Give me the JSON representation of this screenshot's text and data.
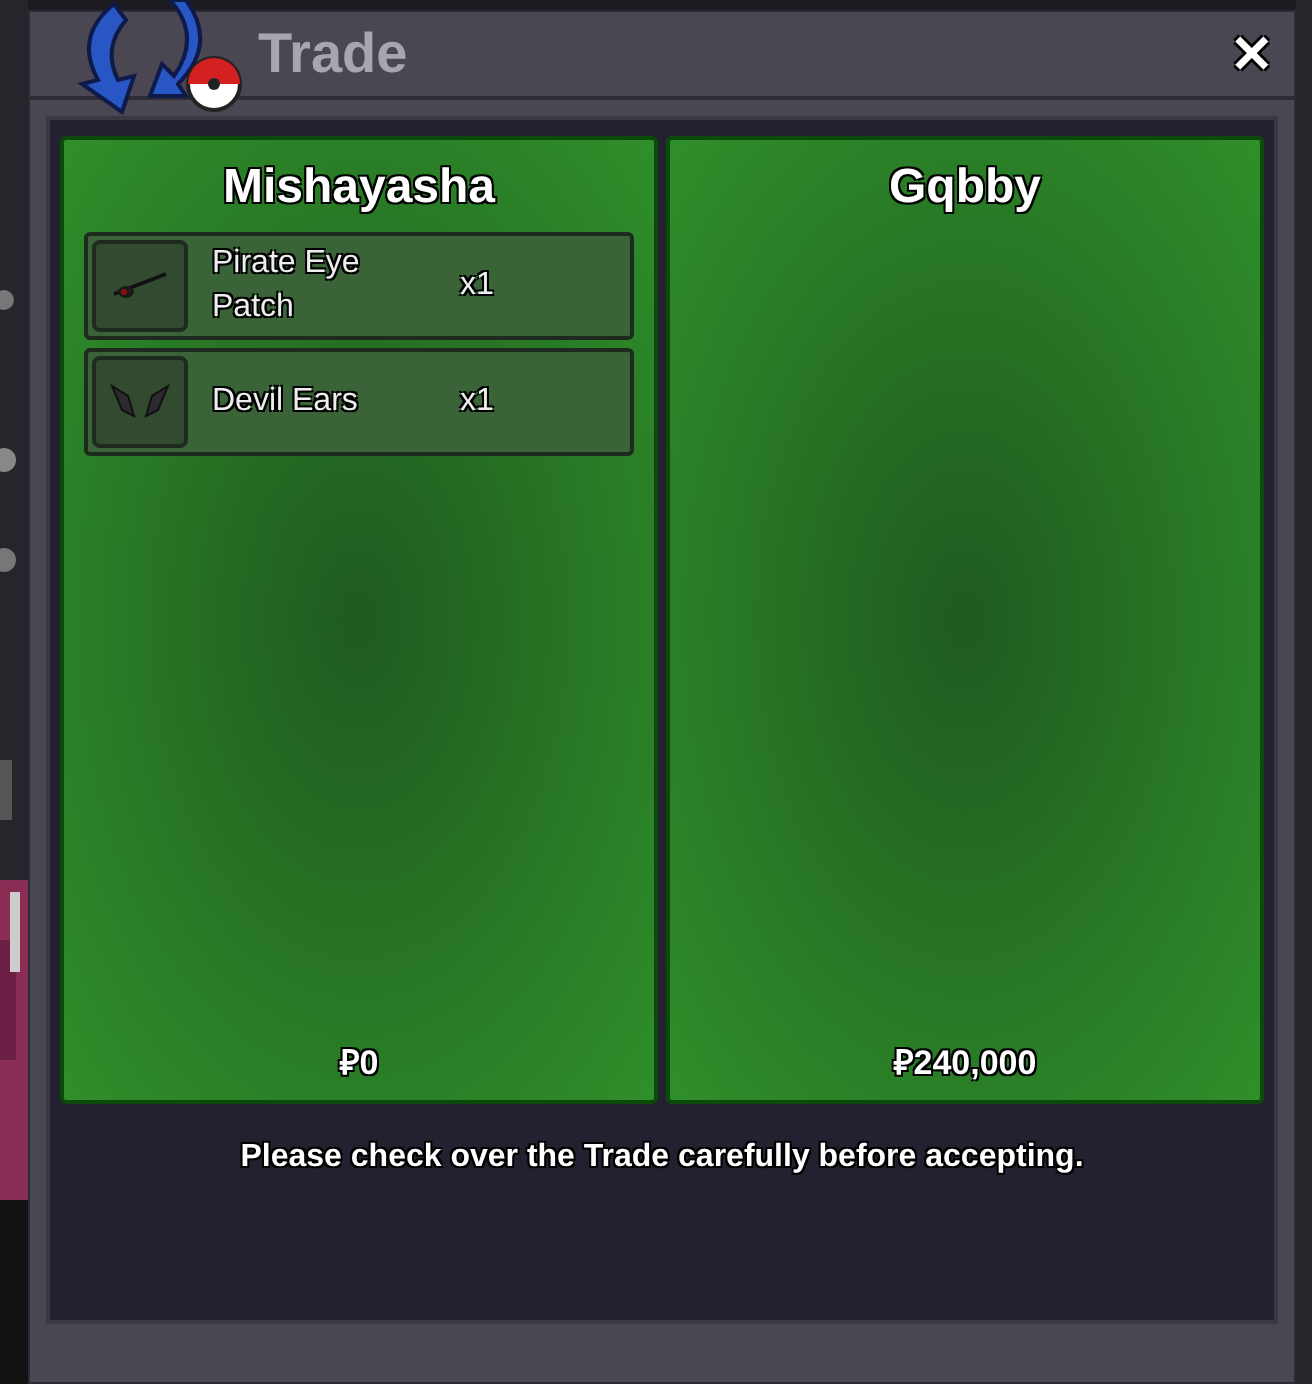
{
  "window": {
    "title": "Trade",
    "close": "✕"
  },
  "offers": [
    {
      "player": "Mishayasha",
      "money": "₽0",
      "items": [
        {
          "name": "Pirate Eye Patch",
          "quantity": "x1",
          "kind": "patch"
        },
        {
          "name": "Devil Ears",
          "quantity": "x1",
          "kind": "ears"
        }
      ]
    },
    {
      "player": "Gqbby",
      "money": "₽240,000"
    }
  ],
  "notice": "Please check over the Trade carefully before accepting."
}
